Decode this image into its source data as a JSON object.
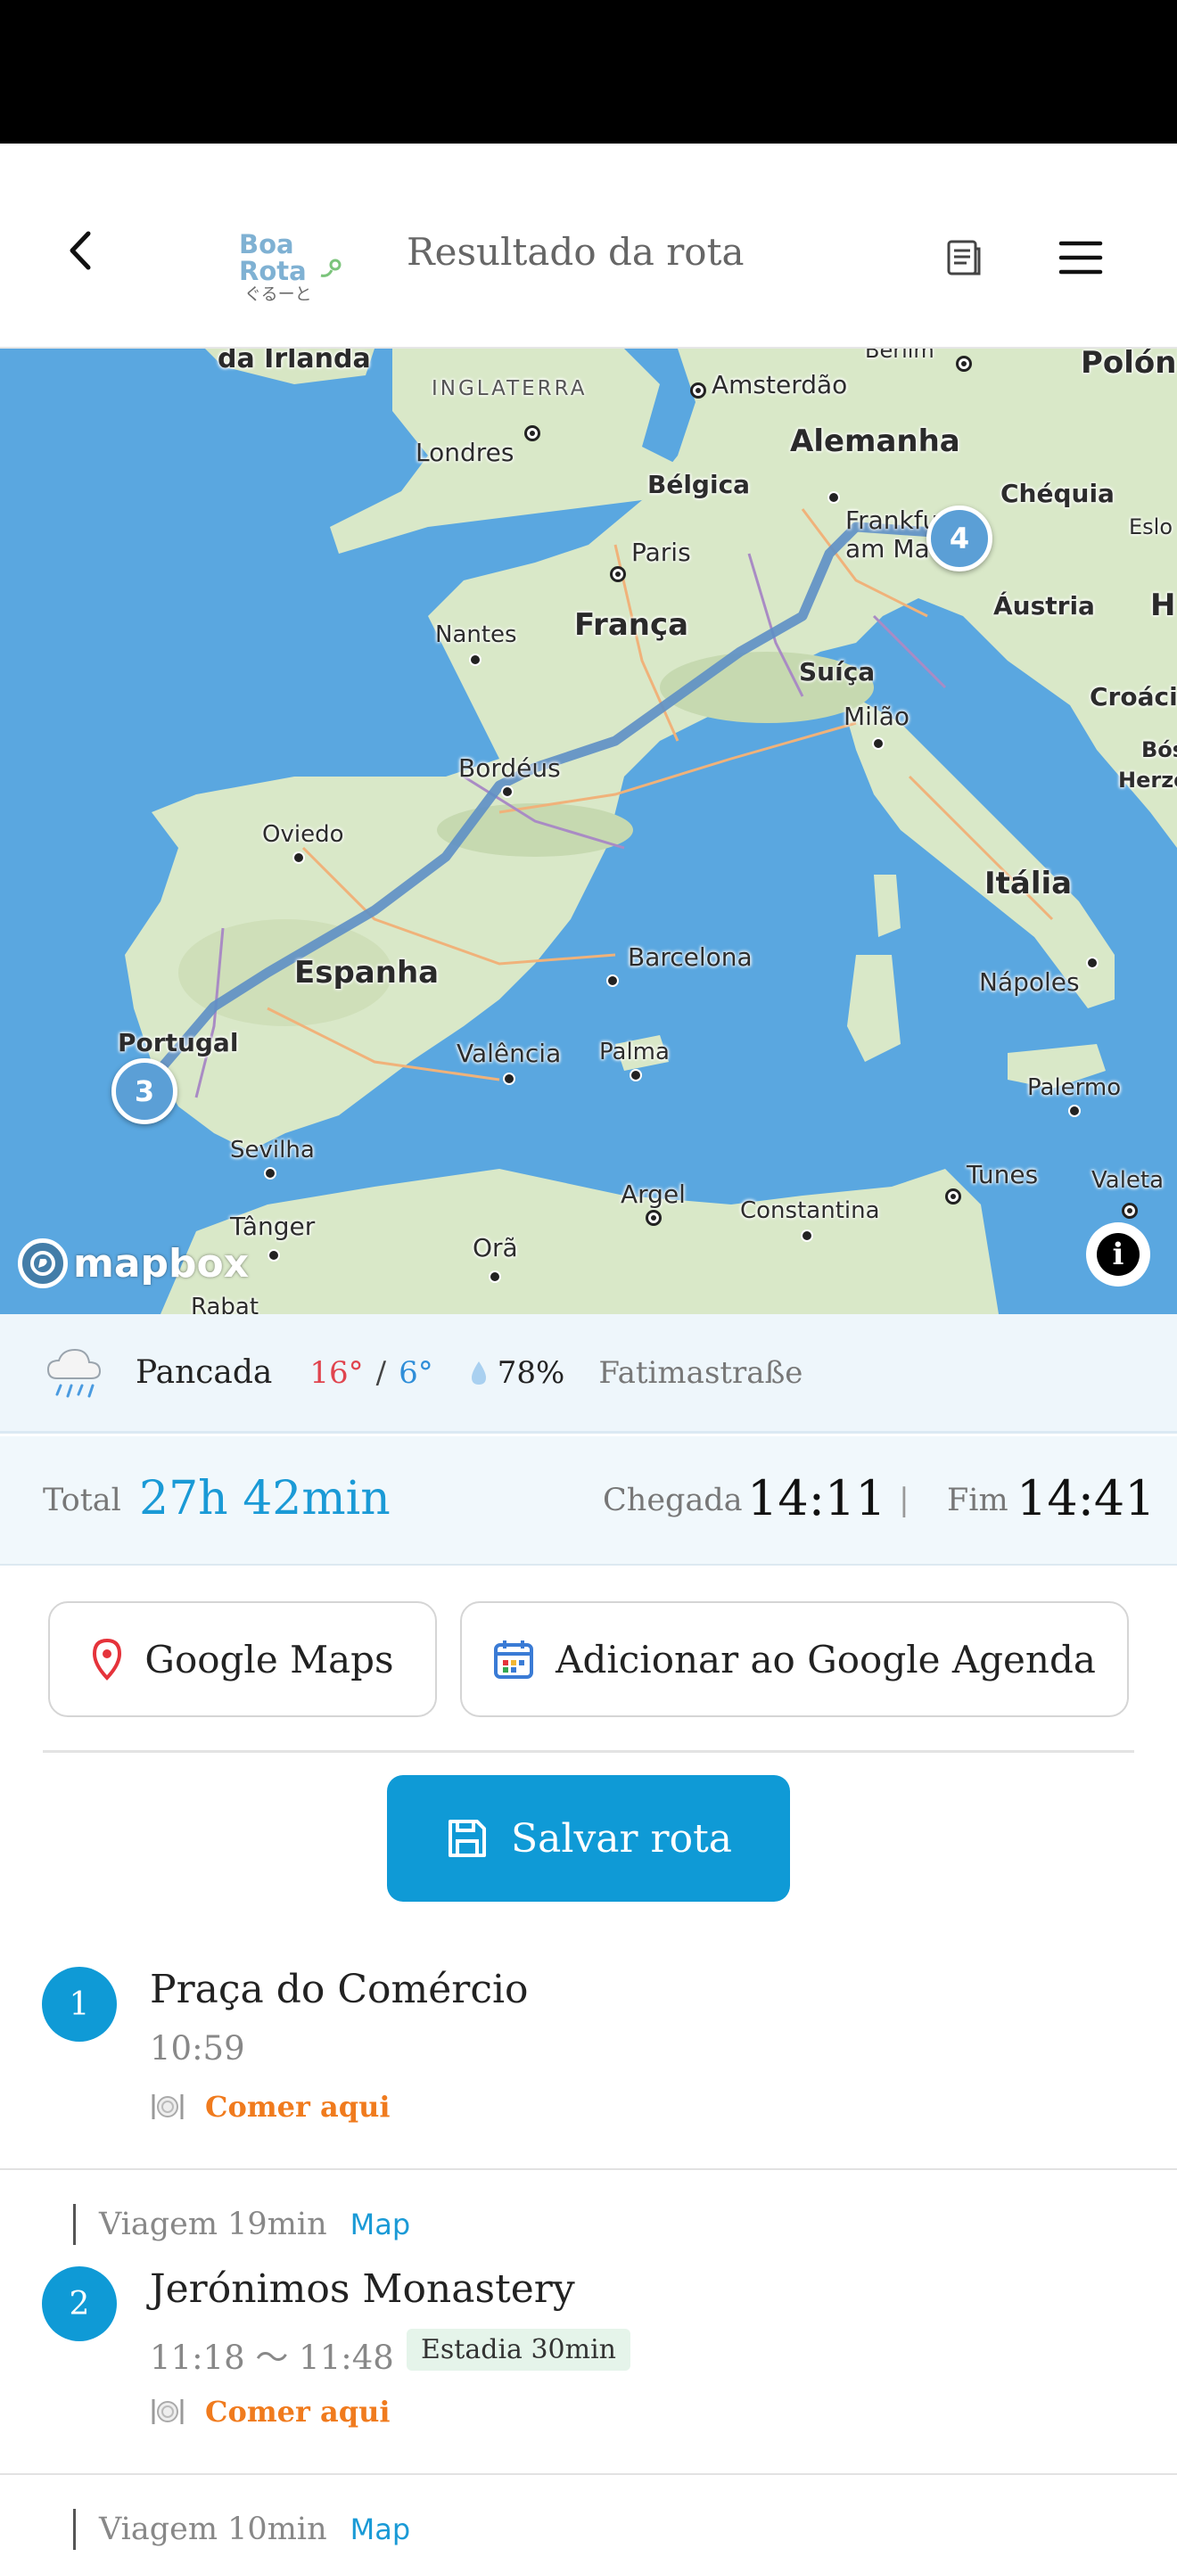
{
  "header": {
    "logo_line1": "Boa",
    "logo_line2": "Rota",
    "logo_sub": "ぐるーと",
    "title": "Resultado da rota",
    "back_icon": "chevron-left-icon",
    "doc_icon": "document-icon",
    "menu_icon": "hamburger-menu-icon"
  },
  "map": {
    "labels": {
      "irlanda": "da Irlanda",
      "inglaterra": "INGLATERRA",
      "amsterdao": "Amsterdão",
      "berlim": "Berlim",
      "polonia": "Polóni",
      "londres": "Londres",
      "alemanha": "Alemanha",
      "belgica": "Bélgica",
      "frankfurt": "Frankfu",
      "frankfurt2": "am Ma",
      "chequia": "Chéquia",
      "eslo": "Eslo",
      "paris": "Paris",
      "austria": "Áustria",
      "h": "H",
      "nantes": "Nantes",
      "franca": "França",
      "suica": "Suíça",
      "milao": "Milão",
      "croacia": "Croáci",
      "bordeus": "Bordéus",
      "bos": "Bós",
      "herz": "Herze",
      "oviedo": "Oviedo",
      "italia": "Itália",
      "espanha": "Espanha",
      "barcelona": "Barcelona",
      "napoles": "Nápoles",
      "portugal": "Portugal",
      "valencia": "Valência",
      "palma": "Palma",
      "palermo": "Palermo",
      "sevilha": "Sevilha",
      "tunes": "Tunes",
      "valeta": "Valeta",
      "argel": "Argel",
      "constantina": "Constantina",
      "tanger": "Tânger",
      "orao": "Orã",
      "rabat": "Rabat"
    },
    "marker_a": "3",
    "marker_b": "4",
    "attribution": "mapbox",
    "info_icon": "info-icon",
    "colors": {
      "sea": "#5aa7e0",
      "land": "#d9e8c8",
      "route": "#5d8fc5"
    }
  },
  "weather": {
    "icon": "rain-cloud-icon",
    "description": "Pancada",
    "high": "16°",
    "separator": "/",
    "low": "6°",
    "humidity_icon": "water-drop-icon",
    "humidity": "78%",
    "location": "Fatimastraße"
  },
  "summary": {
    "total_label": "Total",
    "total_value": "27h 42min",
    "arrival_label": "Chegada",
    "arrival_value": "14:11",
    "separator": "|",
    "end_label": "Fim",
    "end_value": "14:41"
  },
  "actions": {
    "google_maps": "Google Maps",
    "google_maps_icon": "map-pin-icon",
    "calendar": "Adicionar ao Google Agenda",
    "calendar_icon": "calendar-icon",
    "save": "Salvar rota",
    "save_icon": "floppy-disk-icon"
  },
  "stops": [
    {
      "number": "1",
      "name": "Praça do Comércio",
      "time": "10:59",
      "eat_label": "Comer aqui",
      "eat_icon": "plate-cutlery-icon"
    },
    {
      "travel_label": "Viagem 19min",
      "map_link": "Map",
      "number": "2",
      "name": "Jerónimos Monastery",
      "time": "11:18 〜 11:48",
      "stay": "Estadia 30min",
      "eat_label": "Comer aqui",
      "eat_icon": "plate-cutlery-icon"
    },
    {
      "travel_label": "Viagem 10min",
      "map_link": "Map"
    }
  ]
}
